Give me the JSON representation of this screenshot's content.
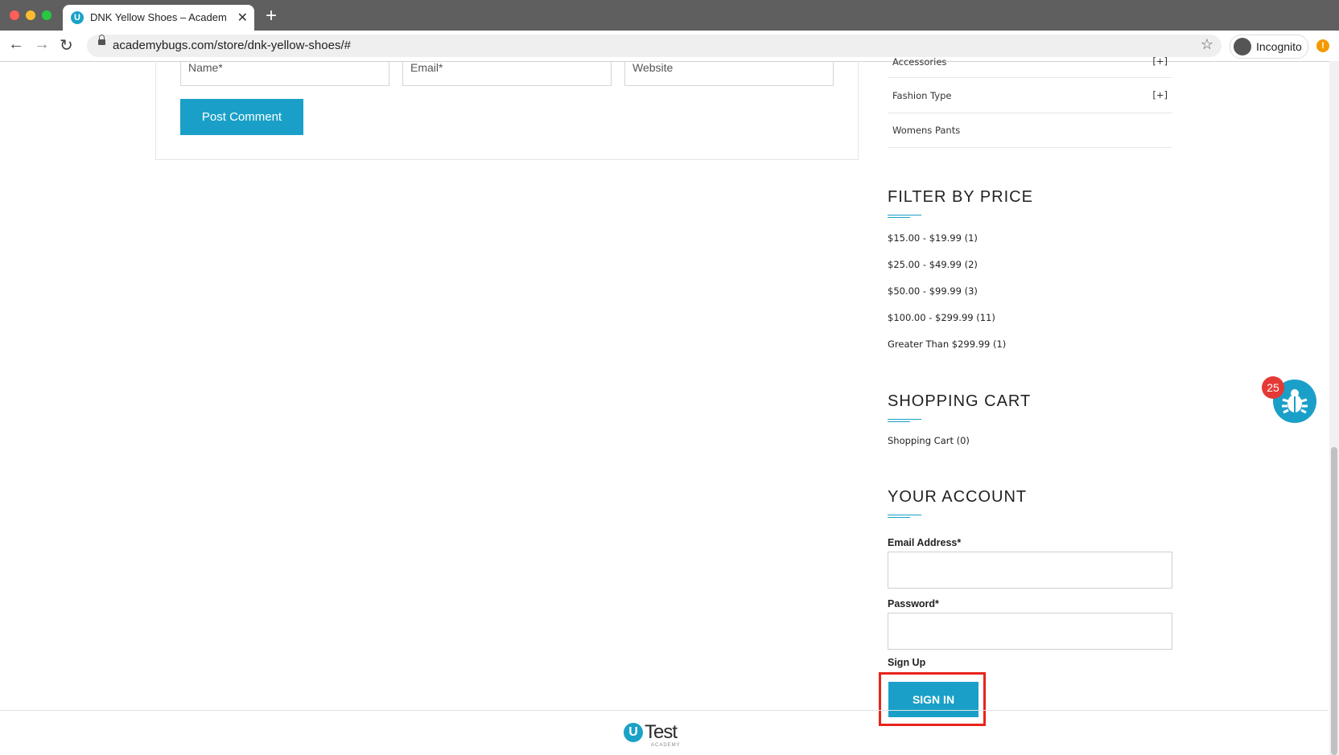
{
  "browser": {
    "tab_title": "DNK Yellow Shoes – AcademyBugs",
    "favicon_letter": "U",
    "url": "academybugs.com/store/dnk-yellow-shoes/#",
    "incognito_label": "Incognito",
    "alert_symbol": "!"
  },
  "comment_form": {
    "name_placeholder": "Name*",
    "email_placeholder": "Email*",
    "website_placeholder": "Website",
    "post_button": "Post Comment"
  },
  "categories": [
    {
      "label": "Accessories",
      "toggle": "[+]"
    },
    {
      "label": "Fashion Type",
      "toggle": "[+]"
    },
    {
      "label": "Womens Pants",
      "toggle": ""
    }
  ],
  "filter_by_price": {
    "title": "FILTER BY PRICE",
    "ranges": [
      "$15.00 - $19.99 (1)",
      "$25.00 - $49.99 (2)",
      "$50.00 - $99.99 (3)",
      "$100.00 - $299.99 (11)",
      "Greater Than $299.99 (1)"
    ]
  },
  "shopping_cart": {
    "title": "SHOPPING CART",
    "summary": "Shopping Cart (0)"
  },
  "account": {
    "title": "YOUR ACCOUNT",
    "email_label": "Email Address*",
    "password_label": "Password*",
    "signup_label": "Sign Up",
    "signin_button": "SIGN IN"
  },
  "bug_widget": {
    "count": "25"
  },
  "footer": {
    "logo_letter": "U",
    "logo_text": "Test",
    "logo_sub": "ACADEMY"
  },
  "colors": {
    "accent": "#1aa0c8",
    "highlight": "#e8241c",
    "badge": "#e53935"
  }
}
